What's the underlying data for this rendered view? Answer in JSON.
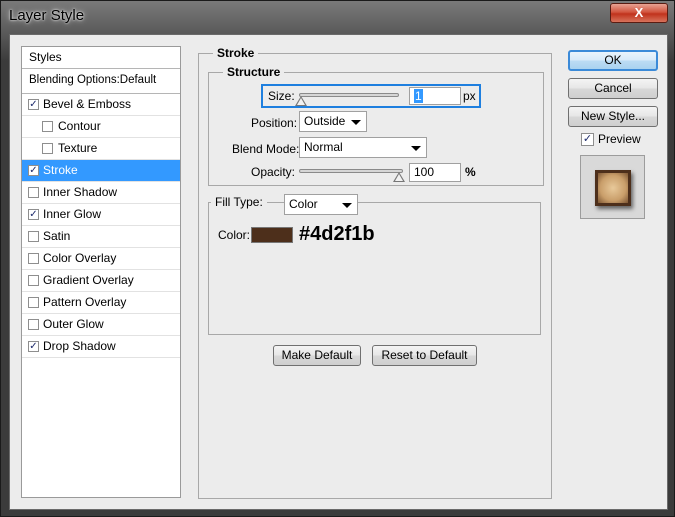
{
  "window": {
    "title": "Layer Style",
    "close_glyph": "X"
  },
  "styles_list": {
    "header": "Styles",
    "blending_options": "Blending Options:Default",
    "items": [
      {
        "label": "Bevel & Emboss",
        "checked": true,
        "indent": false,
        "check": "✓"
      },
      {
        "label": "Contour",
        "checked": false,
        "indent": true,
        "check": ""
      },
      {
        "label": "Texture",
        "checked": false,
        "indent": true,
        "check": ""
      },
      {
        "label": "Stroke",
        "checked": true,
        "indent": false,
        "selected": true,
        "check": "✓"
      },
      {
        "label": "Inner Shadow",
        "checked": false,
        "indent": false,
        "check": ""
      },
      {
        "label": "Inner Glow",
        "checked": true,
        "indent": false,
        "check": "✓"
      },
      {
        "label": "Satin",
        "checked": false,
        "indent": false,
        "check": ""
      },
      {
        "label": "Color Overlay",
        "checked": false,
        "indent": false,
        "check": ""
      },
      {
        "label": "Gradient Overlay",
        "checked": false,
        "indent": false,
        "check": ""
      },
      {
        "label": "Pattern Overlay",
        "checked": false,
        "indent": false,
        "check": ""
      },
      {
        "label": "Outer Glow",
        "checked": false,
        "indent": false,
        "check": ""
      },
      {
        "label": "Drop Shadow",
        "checked": true,
        "indent": false,
        "check": "✓"
      }
    ]
  },
  "stroke": {
    "title": "Stroke",
    "structure": {
      "title": "Structure",
      "size_label": "Size:",
      "size_value": "1",
      "size_unit": "px",
      "position_label": "Position:",
      "position_value": "Outside",
      "blend_mode_label": "Blend Mode:",
      "blend_mode_value": "Normal",
      "opacity_label": "Opacity:",
      "opacity_value": "100",
      "opacity_unit": "%"
    },
    "fill": {
      "fill_type_label": "Fill Type:",
      "fill_type_value": "Color",
      "color_label": "Color:",
      "color_hex": "#4d2f1b",
      "color_text": "#4d2f1b"
    },
    "make_default": "Make Default",
    "reset_to_default": "Reset to Default"
  },
  "buttons": {
    "ok": "OK",
    "cancel": "Cancel",
    "new_style": "New Style...",
    "preview_label": "Preview",
    "preview_checked": true,
    "preview_check": "✓"
  },
  "colors": {
    "selection": "#3399ff",
    "highlight": "#1e7fdf",
    "stroke_color": "#4d2f1b"
  }
}
